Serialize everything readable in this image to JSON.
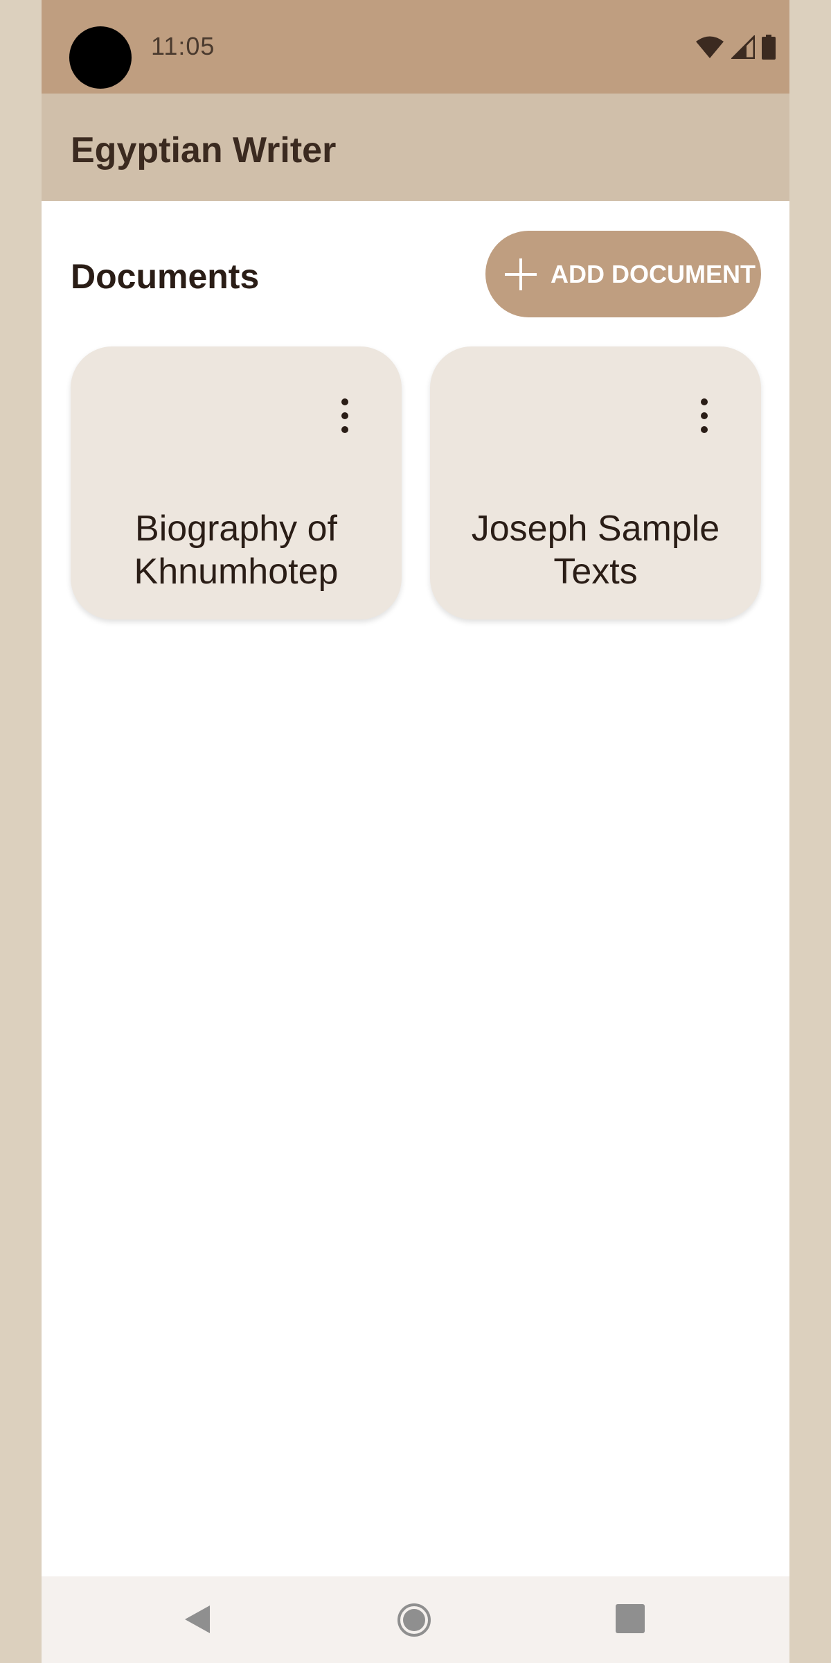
{
  "status_bar": {
    "time": "11:05",
    "icons": [
      "wifi-icon",
      "signal-icon",
      "battery-icon"
    ]
  },
  "app_bar": {
    "title": "Egyptian Writer"
  },
  "main": {
    "section_title": "Documents",
    "add_button_label": "ADD DOCUMENT",
    "documents": [
      {
        "title": "Biography of Khnumhotep"
      },
      {
        "title": "Joseph Sample Texts"
      }
    ]
  },
  "nav_bar": {
    "buttons": [
      "back-icon",
      "home-icon",
      "recents-icon"
    ]
  },
  "colors": {
    "status_bar": "#bf9e80",
    "app_bar": "#d0bfaa",
    "card": "#ede6de",
    "accent": "#bf9e80",
    "page_margin": "#dcd0be"
  }
}
